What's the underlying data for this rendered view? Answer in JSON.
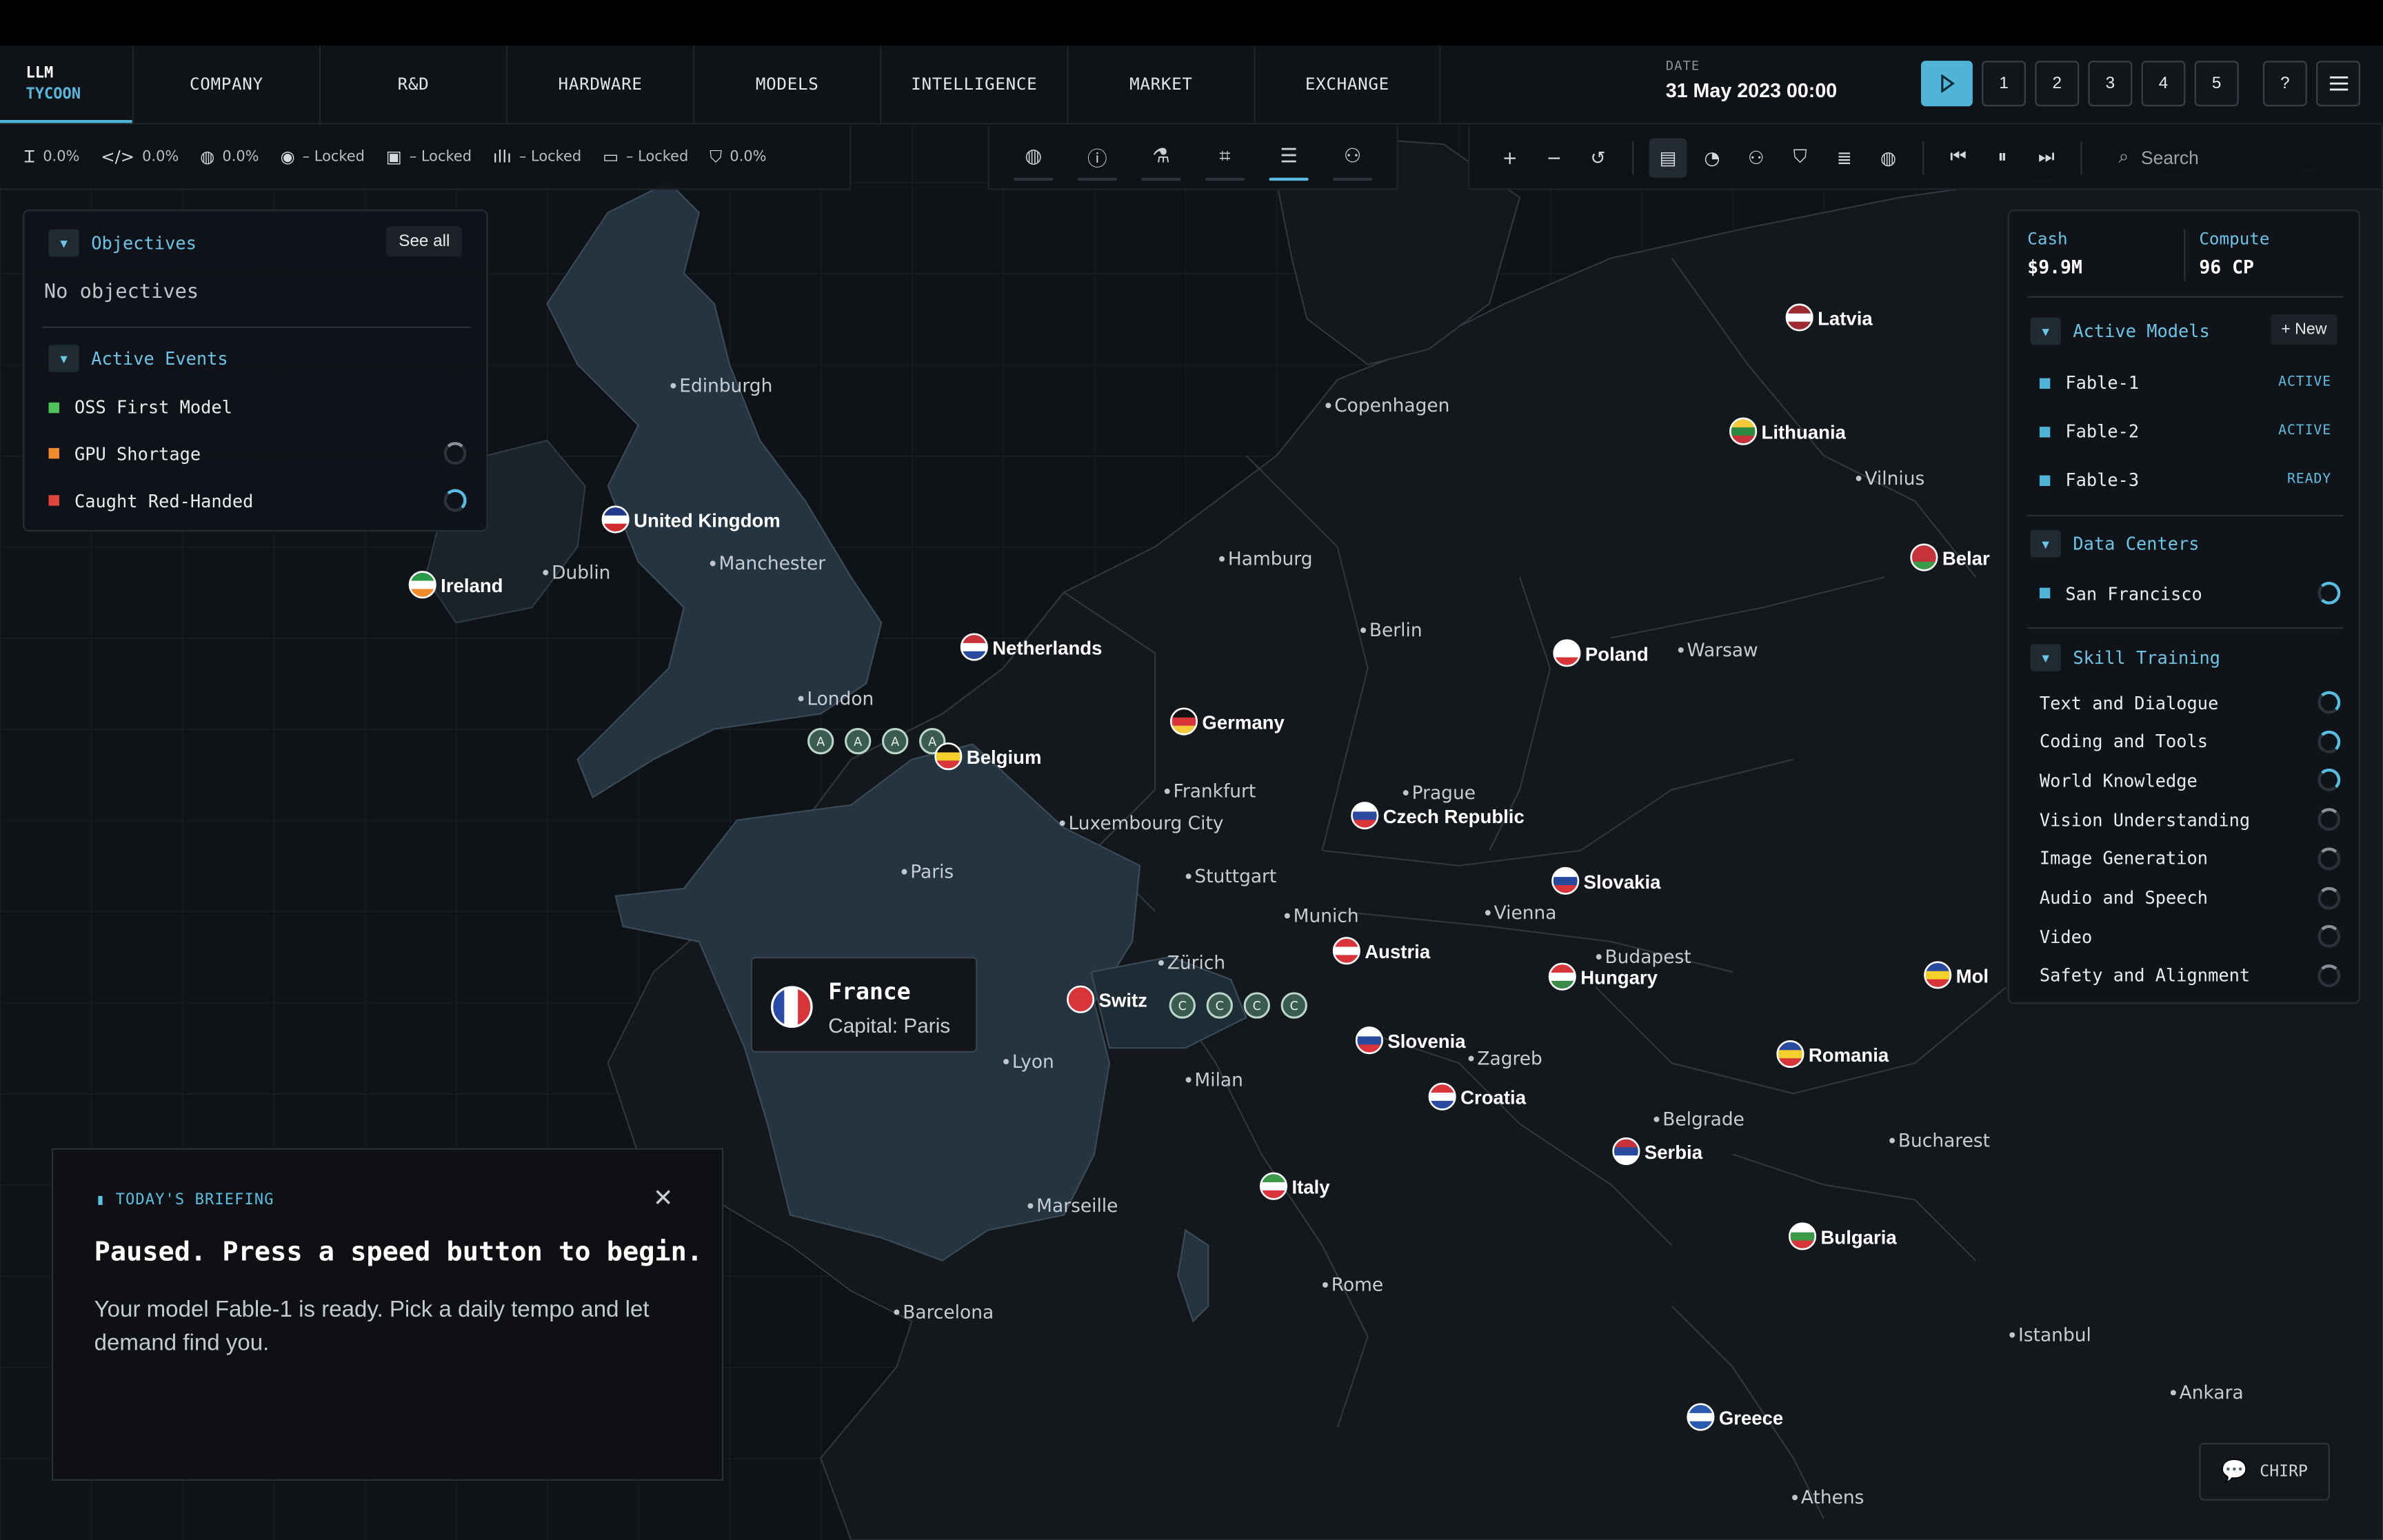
{
  "brand": {
    "line1": "LLM",
    "line2": "TYCOON"
  },
  "nav": {
    "tabs": [
      "COMPANY",
      "R&D",
      "HARDWARE",
      "MODELS",
      "INTELLIGENCE",
      "MARKET",
      "EXCHANGE"
    ]
  },
  "date": {
    "label": "DATE",
    "value": "31 May 2023  00:00"
  },
  "speed": {
    "play_icon": "play-icon",
    "buttons": [
      "1",
      "2",
      "3",
      "4",
      "5"
    ],
    "help": "?",
    "menu_icon": "menu-icon"
  },
  "stats": [
    {
      "icon": "text-icon",
      "value": "0.0%"
    },
    {
      "icon": "code-icon",
      "value": "0.0%"
    },
    {
      "icon": "globe-icon",
      "value": "0.0%"
    },
    {
      "icon": "eye-icon",
      "value": "– Locked"
    },
    {
      "icon": "image-icon",
      "value": "– Locked"
    },
    {
      "icon": "audio-icon",
      "value": "– Locked"
    },
    {
      "icon": "video-icon",
      "value": "– Locked"
    },
    {
      "icon": "shield-icon",
      "value": "0.0%"
    }
  ],
  "search": {
    "placeholder": "Search"
  },
  "objectives": {
    "title": "Objectives",
    "see_all": "See all",
    "empty": "No objectives",
    "events_title": "Active Events",
    "events": [
      {
        "label": "OSS First Model",
        "color": "#4ec35a"
      },
      {
        "label": "GPU Shortage",
        "color": "#f08a2a"
      },
      {
        "label": "Caught Red-Handed",
        "color": "#e0443a"
      }
    ]
  },
  "resources": {
    "cash_label": "Cash",
    "cash_value": "$9.9M",
    "compute_label": "Compute",
    "compute_value": "96 CP"
  },
  "models": {
    "title": "Active Models",
    "new_label": "+ New",
    "items": [
      {
        "name": "Fable-1",
        "status": "ACTIVE"
      },
      {
        "name": "Fable-2",
        "status": "ACTIVE"
      },
      {
        "name": "Fable-3",
        "status": "READY"
      }
    ]
  },
  "datacenters": {
    "title": "Data Centers",
    "items": [
      "San Francisco"
    ]
  },
  "skills": {
    "title": "Skill Training",
    "items": [
      "Text and Dialogue",
      "Coding and Tools",
      "World Knowledge",
      "Vision Understanding",
      "Image Generation",
      "Audio and Speech",
      "Video",
      "Safety and Alignment"
    ]
  },
  "briefing": {
    "heading": "TODAY'S BRIEFING",
    "title": "Paused. Press a speed button to begin.",
    "body": "Your model Fable-1 is ready. Pick a daily tempo and let demand find you."
  },
  "tooltip": {
    "country": "France",
    "capital": "Capital: Paris"
  },
  "chirp": {
    "label": "CHIRP"
  },
  "map": {
    "countries": [
      "United Kingdom",
      "Ireland",
      "Netherlands",
      "Belgium",
      "Germany",
      "Poland",
      "Latvia",
      "Lithuania",
      "Belar",
      "Czech Republic",
      "Slovakia",
      "Austria",
      "Hungary",
      "Slovenia",
      "Croatia",
      "Serbia",
      "Romania",
      "Bulgaria",
      "Italy",
      "Greece",
      "Switz",
      "Mol",
      "France"
    ],
    "cities": [
      "Edinburgh",
      "Copenhagen",
      "Vilnius",
      "Dublin",
      "Manchester",
      "Hamburg",
      "Berlin",
      "Warsaw",
      "London",
      "Frankfurt",
      "Prague",
      "Luxembourg City",
      "Paris",
      "Stuttgart",
      "Munich",
      "Vienna",
      "Zürich",
      "Budapest",
      "Lyon",
      "Milan",
      "Zagreb",
      "Belgrade",
      "Bucharest",
      "Marseille",
      "Rome",
      "Barcelona",
      "Istanbul",
      "Ankara",
      "Athens"
    ],
    "markers_a": [
      "A",
      "A",
      "A",
      "A"
    ],
    "markers_c": [
      "C",
      "C",
      "C",
      "C"
    ]
  }
}
